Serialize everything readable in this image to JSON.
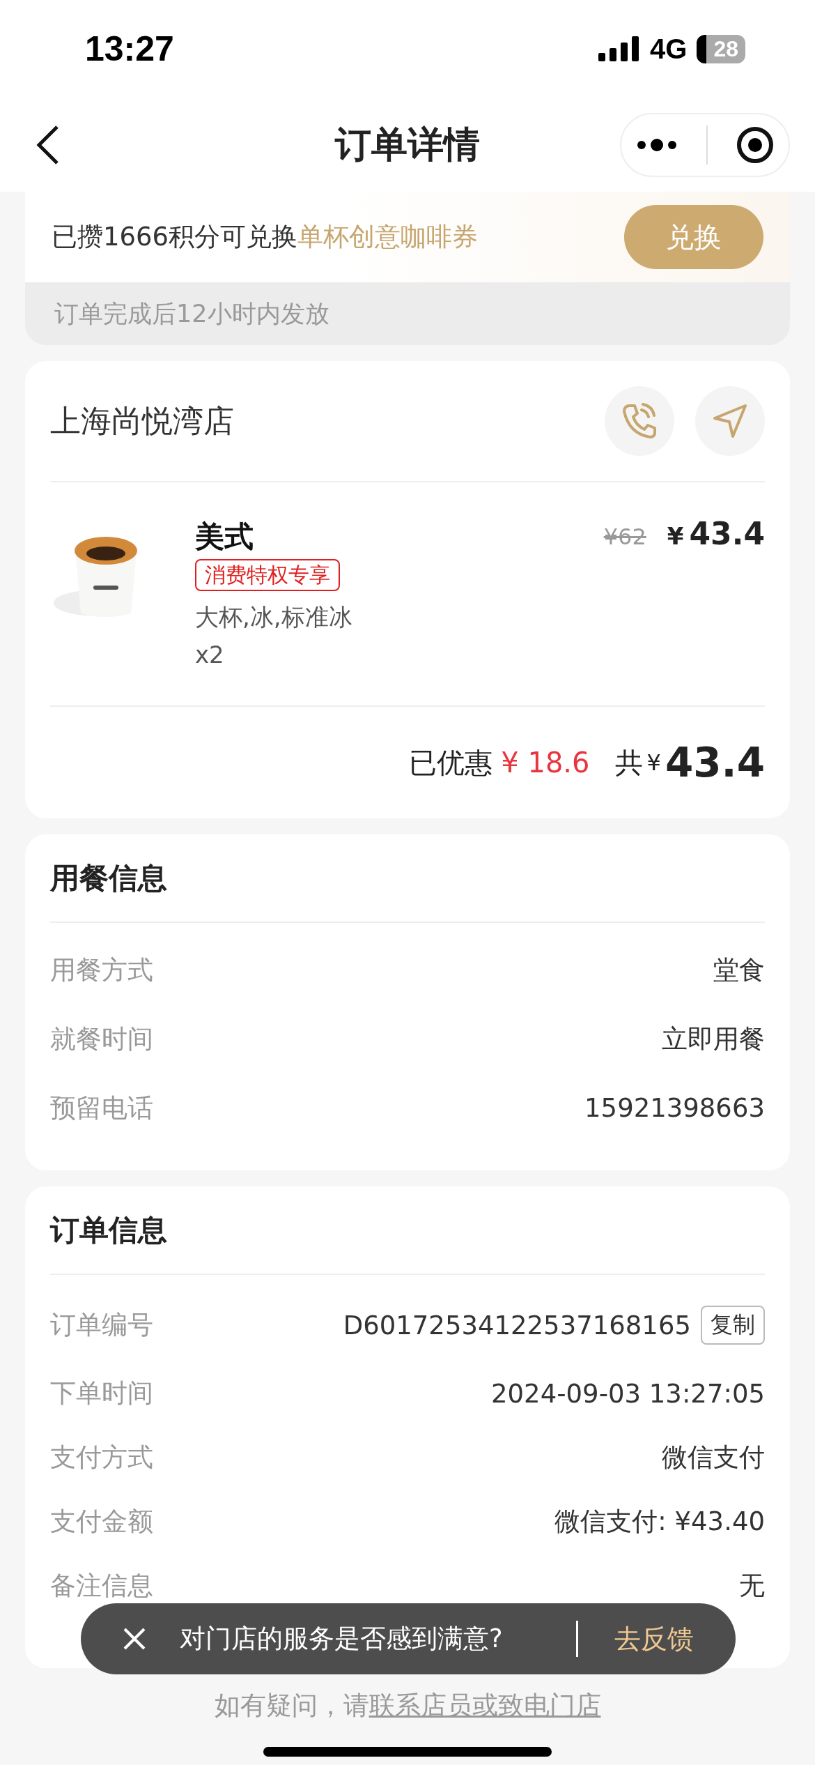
{
  "status_bar": {
    "time": "13:27",
    "network": "4G",
    "battery": "28"
  },
  "nav": {
    "title": "订单详情"
  },
  "points_banner": {
    "text": "已攒1666积分可兑换",
    "highlight": "单杯创意咖啡券",
    "button": "兑换",
    "note": "订单完成后12小时内发放"
  },
  "store": {
    "name": "上海尚悦湾店",
    "items": [
      {
        "kind": "picture",
        "name": "美式",
        "tag": "消费特权专享",
        "specs": "大杯,冰,标准冰",
        "qty": "x2",
        "original_price": "¥62",
        "currency": "¥",
        "price": "43.4"
      }
    ],
    "summary": {
      "discount_label": "已优惠",
      "discount": "¥ 18.6",
      "total_label": "共",
      "total_currency": "¥",
      "total": "43.4"
    }
  },
  "dining_info": {
    "title": "用餐信息",
    "rows": [
      {
        "label": "用餐方式",
        "value": "堂食"
      },
      {
        "label": "就餐时间",
        "value": "立即用餐"
      },
      {
        "label": "预留电话",
        "value": "15921398663"
      }
    ]
  },
  "order_info": {
    "title": "订单信息",
    "rows": [
      {
        "label": "订单编号",
        "value": "D60172534122537168165",
        "action": "复制"
      },
      {
        "label": "下单时间",
        "value": "2024-09-03 13:27:05"
      },
      {
        "label": "支付方式",
        "value": "微信支付"
      },
      {
        "label": "支付金额",
        "value": "微信支付: ¥43.40"
      },
      {
        "label": "备注信息",
        "value": "无"
      }
    ]
  },
  "toast": {
    "text": "对门店的服务是否感到满意?",
    "action": "去反馈"
  },
  "footer": {
    "text": "如有疑问，请",
    "link": "联系店员或致电门店"
  }
}
